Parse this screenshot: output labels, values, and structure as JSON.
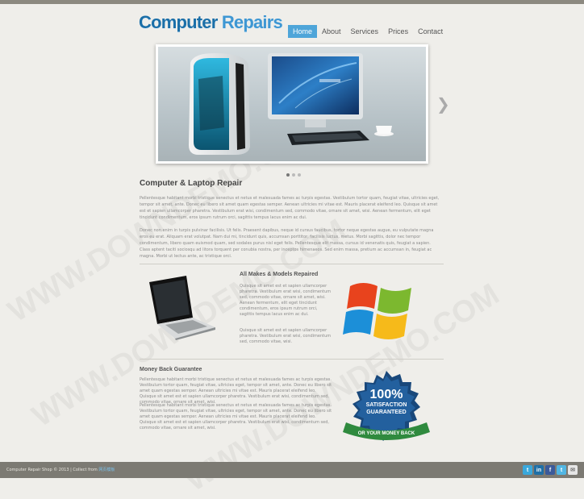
{
  "site": {
    "logo_word1": "Computer",
    "logo_word2": "Repairs"
  },
  "nav": {
    "items": [
      {
        "label": "Home",
        "active": true
      },
      {
        "label": "About",
        "active": false
      },
      {
        "label": "Services",
        "active": false
      },
      {
        "label": "Prices",
        "active": false
      },
      {
        "label": "Contact",
        "active": false
      }
    ]
  },
  "slider": {
    "arrow_icon": "chevron-right-icon",
    "current_slide": 1,
    "slide_count": 3
  },
  "main": {
    "heading": "Computer & Laptop Repair",
    "intro_p1": "Pellentesque habitant morbi tristique senectus et netus et malesuada fames ac turpis egestas. Vestibulum tortor quam, feugiat vitae, ultricies eget, tempor sit amet, ante. Donec eu libero sit amet quam egestas semper. Aenean ultricies mi vitae est. Mauris placerat eleifend leo. Quisque sit amet est et sapien ullamcorper pharetra. Vestibulum erat wisi, condimentum sed, commodo vitae, ornare sit amet, wisi. Aenean fermentum, elit eget tincidunt condimentum, eros ipsum rutrum orci, sagittis tempus lacus enim ac dui.",
    "intro_p2": "Donec non enim in turpis pulvinar facilisis. Ut felis. Praesent dapibus, neque id cursus faucibus, tortor neque egestas augue, eu vulputate magna eros eu erat. Aliquam erat volutpat. Nam dui mi, tincidunt quis, accumsan porttitor, facilisis luctus, metus. Morbi sagittis, dolor nec tempor condimentum, libero quam euismod quam, sed sodales purus nisl eget felis. Pellentesque elit massa, cursus id venenatis quis, feugiat a sapien. Class aptent taciti sociosqu ad litora torquent per conubia nostra, per inceptos himenaeos. Sed enim massa, pretium ac accumsan in, feugiat ac magna. Morbi ut lectus ante, ac tristique orci."
  },
  "makes": {
    "title": "All Makes & Models Repaired",
    "p1": "Quisque sit amet est et sapien ullamcorper pharetra. Vestibulum erat wisi, condimentum sed, commodo vitae, ornare sit amet, wisi. Aenean fermentum, elit eget tincidunt condimentum, eros ipsum rutrum orci, sagittis tempus lacus enim ac dui.",
    "p2": "Quisque sit amet est et sapien ullamcorper pharetra. Vestibulum erat wisi, condimentum sed, commodo vitae, wisi."
  },
  "guarantee": {
    "title": "Money Back Guarantee",
    "p1": "Pellentesque habitant morbi tristique senectus et netus et malesuada fames ac turpis egestas. Vestibulum tortor quam, feugiat vitae, ultricies eget, tempor sit amet, ante. Donec eu libero sit amet quam egestas semper. Aenean ultricies mi vitae est. Mauris placerat eleifend leo. Quisque sit amet est et sapien ullamcorper pharetra. Vestibulum erat wisi, condimentum sed, commodo vitae, ornare sit amet, wisi.",
    "p2": "Pellentesque habitant morbi tristique senectus et netus et malesuada fames ac turpis egestas. Vestibulum tortor quam, feugiat vitae, ultricies eget, tempor sit amet, ante. Donec eu libero sit amet quam egestas semper. Aenean ultricies mi vitae est. Mauris placerat eleifend leo. Quisque sit amet est et sapien ullamcorper pharetra. Vestibulum erat wisi, condimentum sed, commodo vitae, ornare sit amet, wisi.",
    "badge_line1": "100%",
    "badge_line2": "SATISFACTION",
    "badge_line3": "GUARANTEED",
    "badge_ribbon": "OR YOUR MONEY BACK"
  },
  "footer": {
    "copyright": "Computer Repair Shop © 2013 | Collect from",
    "link_label": "网页模板"
  },
  "social": [
    "twitter-icon",
    "linkedin-icon",
    "facebook-icon",
    "twitter-icon",
    "email-icon"
  ],
  "watermark_text": "WWW.DOWNDEMO.COM",
  "colors": {
    "brand_blue": "#1b6fa8",
    "nav_active": "#4ea5d9",
    "footer": "#7c7a73",
    "page_bg": "#efeeea"
  }
}
